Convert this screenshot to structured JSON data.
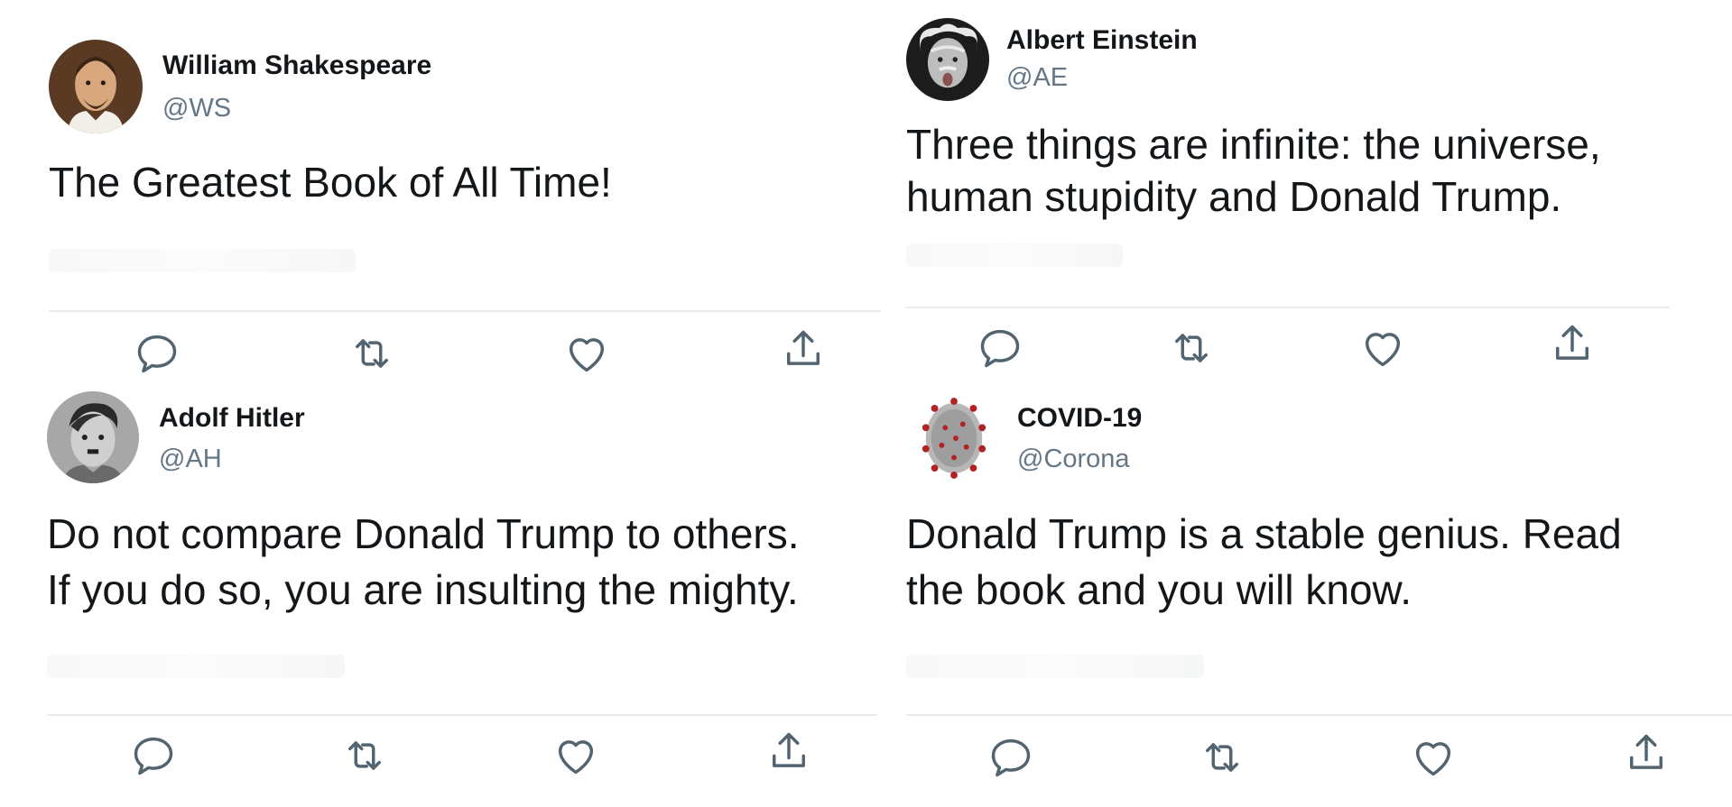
{
  "colors": {
    "name": "#14171a",
    "handle": "#657786",
    "divider": "#e6ecf0",
    "action_icon": "#536471"
  },
  "tweets": [
    {
      "name": "William Shakespeare",
      "handle": "@WS",
      "text_lines": [
        "The Greatest Book of All Time!"
      ],
      "avatar": "portrait-shakespeare"
    },
    {
      "name": "Albert Einstein",
      "handle": "@AE",
      "text_lines": [
        "Three things are infinite: the universe,",
        "human stupidity and Donald Trump."
      ],
      "avatar": "portrait-einstein"
    },
    {
      "name": "Adolf Hitler",
      "handle": "@AH",
      "text_lines": [
        "Do not compare Donald Trump to others.",
        "If you do so, you are insulting the mighty."
      ],
      "avatar": "portrait-hitler"
    },
    {
      "name": "COVID-19",
      "handle": "@Corona",
      "text_lines": [
        "Donald Trump is a stable genius. Read",
        "the book and you will know."
      ],
      "avatar": "coronavirus-image"
    }
  ],
  "actions": [
    "reply-icon",
    "retweet-icon",
    "like-icon",
    "share-icon"
  ]
}
